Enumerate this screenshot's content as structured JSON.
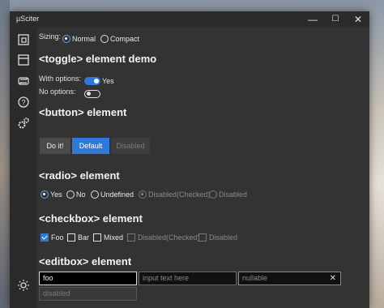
{
  "window": {
    "title": "µSciter",
    "minimize": "—",
    "maximize": "☐",
    "close": "✕"
  },
  "sidebar": {
    "items": [
      {
        "icon": "window-dock-icon"
      },
      {
        "icon": "window-frame-icon"
      },
      {
        "icon": "sync-icon"
      },
      {
        "icon": "help-icon"
      },
      {
        "icon": "settings-gears-icon"
      },
      {
        "icon": "theme-sun-icon"
      }
    ]
  },
  "sizing": {
    "label": "Sizing:",
    "options": [
      "Normal",
      "Compact"
    ],
    "selected": "Normal"
  },
  "toggle": {
    "heading": "<toggle> element demo",
    "with_options_label": "With options:",
    "with_options_value": "Yes",
    "no_options_label": "No options:"
  },
  "button": {
    "heading": "<button> element",
    "labels": [
      "Do it!",
      "Default",
      "Disabled"
    ]
  },
  "radio": {
    "heading": "<radio> element",
    "options": [
      "Yes",
      "No",
      "Undefined",
      "Disabled(Checked)",
      "Disabled"
    ]
  },
  "checkbox": {
    "heading": "<checkbox> element",
    "options": [
      "Foo",
      "Bar",
      "Mixed",
      "Disabled(Checked)",
      "Disabled"
    ]
  },
  "editbox": {
    "heading": "<editbox> element",
    "value1": "foo",
    "placeholder2": "input text here",
    "placeholder3": "nullable",
    "clear": "✕",
    "disabled_placeholder": "disabled"
  },
  "colors": {
    "accent": "#2f78d8",
    "background": "#333333",
    "sidebar": "#2a2a2a"
  }
}
